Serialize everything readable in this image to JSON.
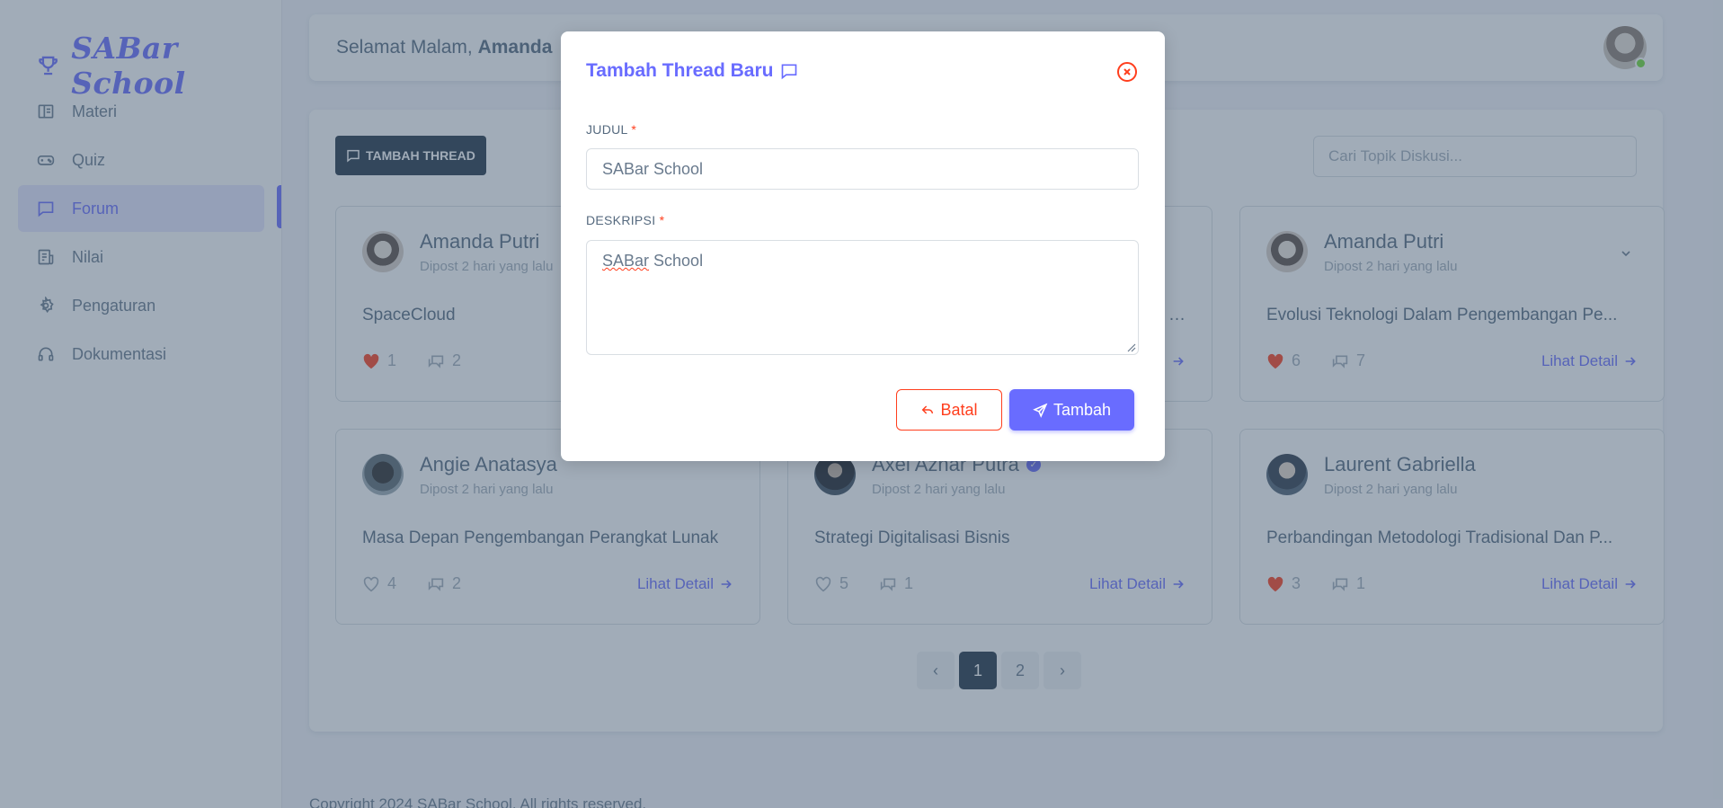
{
  "app": {
    "brand": "SABar School",
    "colors": {
      "primary": "#696cff",
      "danger": "#ff3e1d",
      "dark": "#233446",
      "liked": "#ff3e1d",
      "online": "#71dd37"
    }
  },
  "sidebar": {
    "items": [
      {
        "label": "Materi",
        "icon": "book-icon",
        "active": false
      },
      {
        "label": "Quiz",
        "icon": "gamepad-icon",
        "active": false
      },
      {
        "label": "Forum",
        "icon": "chat-icon",
        "active": true
      },
      {
        "label": "Nilai",
        "icon": "report-icon",
        "active": false
      },
      {
        "label": "Pengaturan",
        "icon": "gear-icon",
        "active": false
      },
      {
        "label": "Dokumentasi",
        "icon": "headset-icon",
        "active": false
      }
    ]
  },
  "navbar": {
    "greeting_prefix": "Selamat Malam, ",
    "user_name": "Amanda"
  },
  "toolbar": {
    "add_thread_label": "TAMBAH THREAD",
    "search_placeholder": "Cari Topik Diskusi..."
  },
  "threads": [
    {
      "author": "Amanda Putri",
      "time": "Dipost 2 hari yang lalu",
      "title": "SpaceCloud",
      "likes": "1",
      "liked": true,
      "comments": "2",
      "detail": "Lihat Detail"
    },
    {
      "author": "",
      "time": "",
      "title": "…",
      "likes": "",
      "liked": false,
      "comments": "",
      "detail": ""
    },
    {
      "author": "Amanda Putri",
      "time": "Dipost 2 hari yang lalu",
      "title": "Evolusi Teknologi Dalam Pengembangan Pe...",
      "likes": "6",
      "liked": true,
      "comments": "7",
      "detail": "Lihat Detail"
    },
    {
      "author": "Angie Anatasya",
      "time": "Dipost 2 hari yang lalu",
      "title": "Masa Depan Pengembangan Perangkat Lunak",
      "likes": "4",
      "liked": false,
      "comments": "2",
      "detail": "Lihat Detail"
    },
    {
      "author": "Axel Azhar Putra",
      "time": "Dipost 2 hari yang lalu",
      "title": "Strategi Digitalisasi Bisnis",
      "likes": "5",
      "liked": false,
      "comments": "1",
      "detail": "Lihat Detail",
      "verified": true
    },
    {
      "author": "Laurent Gabriella",
      "time": "Dipost 2 hari yang lalu",
      "title": "Perbandingan Metodologi Tradisional Dan P...",
      "likes": "3",
      "liked": true,
      "comments": "1",
      "detail": "Lihat Detail"
    }
  ],
  "pagination": {
    "prev": "‹",
    "pages": [
      "1",
      "2"
    ],
    "current": "1",
    "next": "›"
  },
  "footer": {
    "text": "Copyright 2024 SABar School. All rights reserved."
  },
  "modal": {
    "title": "Tambah Thread Baru",
    "judul_label": "JUDUL",
    "judul_value": "SABar School",
    "deskripsi_label": "DESKRIPSI",
    "deskripsi_value_word1": "SABar",
    "deskripsi_value_word2": " School",
    "required_mark": "*",
    "cancel_label": "Batal",
    "submit_label": "Tambah"
  }
}
